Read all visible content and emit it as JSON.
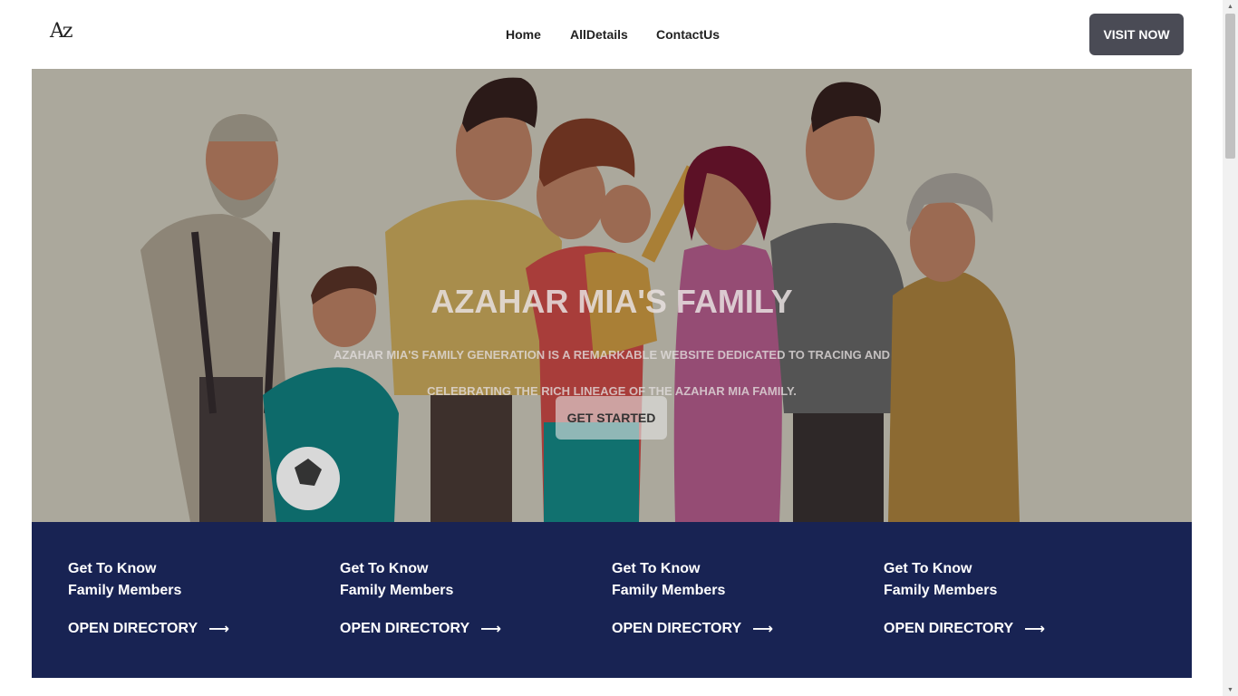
{
  "header": {
    "logo_text": "Az",
    "nav": [
      {
        "label": "Home"
      },
      {
        "label": "AllDetails"
      },
      {
        "label": "ContactUs"
      }
    ],
    "cta_label": "VISIT NOW"
  },
  "hero": {
    "title": "AZAHAR MIA'S FAMILY",
    "description_line1": "AZAHAR MIA'S FAMILY GENERATION IS A REMARKABLE WEBSITE DEDICATED TO TRACING AND",
    "description_line2": "CELEBRATING THE RICH LINEAGE OF THE AZAHAR MIA FAMILY.",
    "button_label": "GET STARTED"
  },
  "directory": {
    "cards": [
      {
        "line1": "Get To Know",
        "line2": "Family Members",
        "link": "OPEN DIRECTORY"
      },
      {
        "line1": "Get To Know",
        "line2": "Family Members",
        "link": "OPEN DIRECTORY"
      },
      {
        "line1": "Get To Know",
        "line2": "Family Members",
        "link": "OPEN DIRECTORY"
      },
      {
        "line1": "Get To Know",
        "line2": "Family Members",
        "link": "OPEN DIRECTORY"
      }
    ]
  },
  "colors": {
    "band_bg": "#182353",
    "hero_bg": "#aba89c",
    "cta_bg": "#4a4b55"
  }
}
